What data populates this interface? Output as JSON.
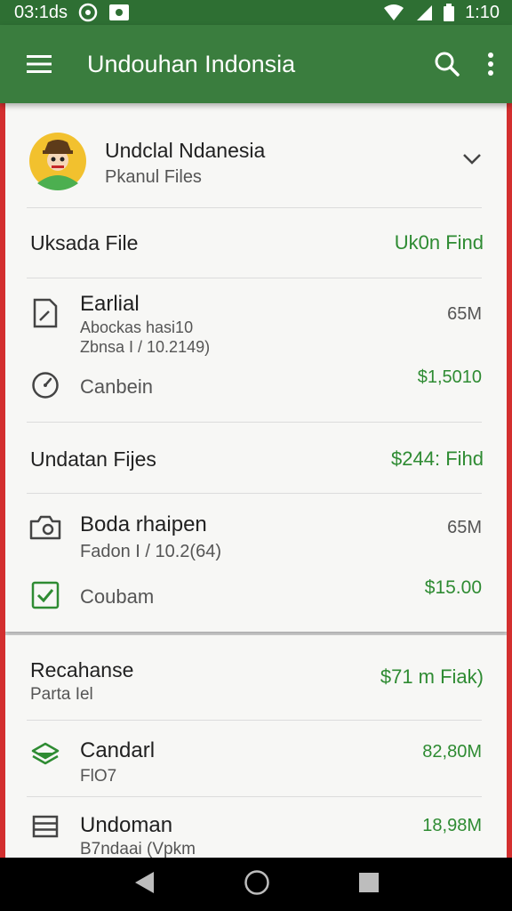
{
  "status_bar": {
    "time_left": "03:1ds",
    "time_right": "1:10"
  },
  "app_bar": {
    "title": "Undouhan Indonsia"
  },
  "account": {
    "name": "Undclal Ndanesia",
    "subtitle": "Pkanul Files"
  },
  "section1": {
    "title": "Uksada File",
    "action": "Uk0n Find"
  },
  "item1": {
    "name": "Earlial",
    "line1": "Abockas hasi10",
    "line2": "Zbnsa I / 10.2149)",
    "size": "65M"
  },
  "item1_sub": {
    "label": "Canbein",
    "amount": "$1,5010"
  },
  "section2": {
    "title": "Undatan Fijes",
    "action": "$244: Fihd"
  },
  "item2": {
    "name": "Boda rhaipen",
    "line1": "Fadon I / 10.2(64)",
    "size": "65M"
  },
  "item2_sub": {
    "label": "Coubam",
    "amount": "$15.00"
  },
  "section3": {
    "title": "Recahanse",
    "subtitle": "Parta Iel",
    "action": "$71 m Fiak)"
  },
  "item3": {
    "name": "Candarl",
    "line1": "FlO7",
    "size": "82,80M"
  },
  "item4": {
    "name": "Undoman",
    "line1": "B7ndaai (Vpkm",
    "size": "18,98M"
  },
  "colors": {
    "appbar": "#3a7d3e",
    "accent": "#2e8b32",
    "strip": "#d32f2f"
  }
}
